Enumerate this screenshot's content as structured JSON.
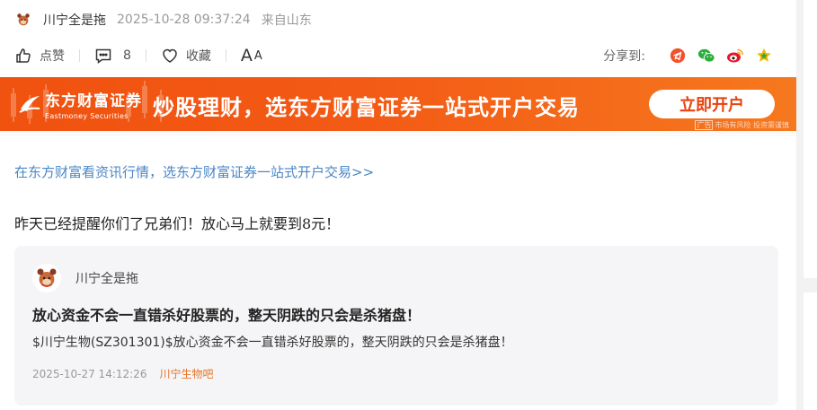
{
  "author": {
    "name": "川宁全是拖",
    "time": "2025-10-28 09:37:24",
    "location": "来自山东"
  },
  "actions": {
    "like_label": "点赞",
    "comment_count": "8",
    "favorite_label": "收藏",
    "font_big": "A",
    "font_small": "A"
  },
  "share": {
    "label": "分享到:",
    "targets": [
      "telegram-icon",
      "wechat-icon",
      "weibo-icon",
      "star-icon"
    ]
  },
  "banner": {
    "brand_cn": "东方财富证券",
    "brand_en": "Eastmoney Securities",
    "slogan": "炒股理财，选东方财富证券一站式开户交易",
    "cta": "立即开户",
    "ad_tag": "广告",
    "ad_note": "市场有风险 投资需谨慎"
  },
  "promo_link": "在东方财富看资讯行情，选东方财富证券一站式开户交易>>",
  "post_text": "昨天已经提醒你们了兄弟们！放心马上就要到8元！",
  "quote": {
    "author": "川宁全是拖",
    "title": "放心资金不会一直错杀好股票的，整天阴跌的只会是杀猪盘！",
    "body": "$川宁生物(SZ301301)$放心资金不会一直错杀好股票的，整天阴跌的只会是杀猪盘！",
    "time": "2025-10-27 14:12:26",
    "bar": "川宁生物吧"
  },
  "colors": {
    "accent_orange": "#f0520f",
    "link_blue": "#4a86c5",
    "bar_orange": "#e8742a"
  }
}
